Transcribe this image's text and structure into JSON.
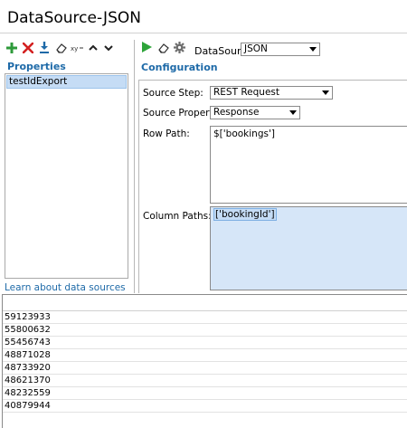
{
  "window": {
    "title": "DataSource-JSON"
  },
  "properties": {
    "section_label": "Properties",
    "toolbar_icons": [
      "add-icon",
      "delete-icon",
      "download-icon",
      "clear-icon",
      "xy-icon",
      "move-up-icon",
      "move-down-icon"
    ],
    "items": [
      {
        "label": "testIdExport",
        "selected": true
      }
    ],
    "learn_link": "Learn about data sources"
  },
  "config": {
    "toolbar_icons": [
      "run-icon",
      "clear-icon",
      "settings-gear-icon"
    ],
    "datasource_label": "DataSource:",
    "datasource_value": "JSON",
    "section_label": "Configuration",
    "source_step_label": "Source Step:",
    "source_step_value": "REST Request",
    "source_property_label": "Source Property:",
    "source_property_value": "Response",
    "row_path_label": "Row Path:",
    "row_path_value": "$['bookings']",
    "column_paths_label": "Column Paths:",
    "column_paths_value": "['bookingId']"
  },
  "results": {
    "rows": [
      "59123933",
      "55800632",
      "55456743",
      "48871028",
      "48733920",
      "48621370",
      "48232559",
      "40879944"
    ]
  },
  "colors": {
    "accent_blue": "#1e6aa8",
    "selection": "#c5dcf5",
    "add_green": "#2e9a3a",
    "delete_red": "#d32020",
    "run_green": "#2ea43a"
  }
}
